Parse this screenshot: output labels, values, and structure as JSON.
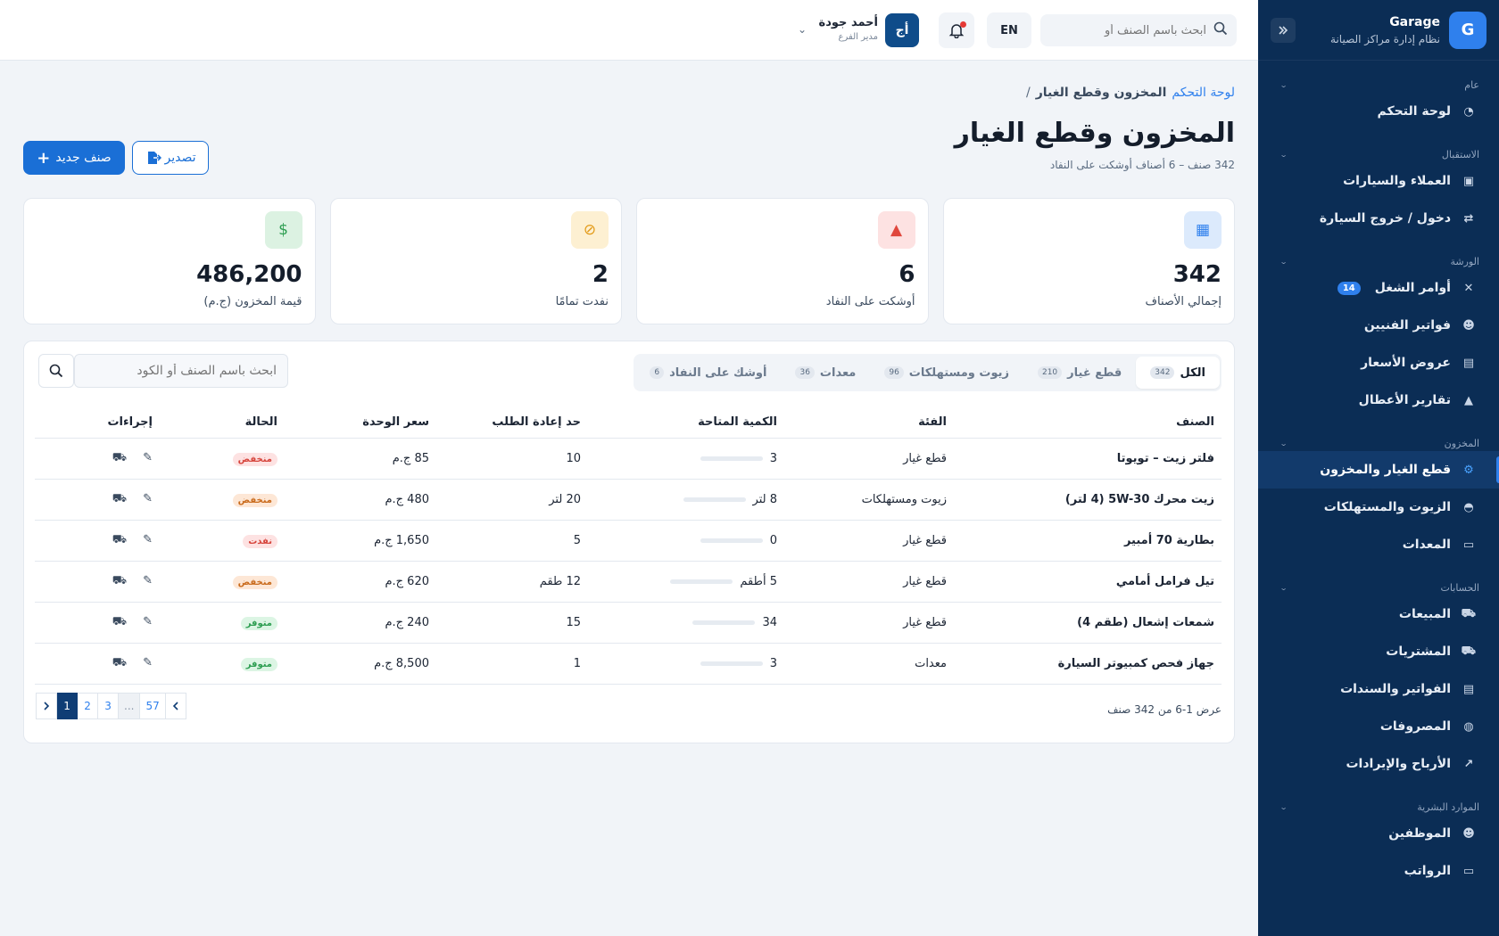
{
  "brand": {
    "name": "Garage",
    "subtitle": "نظام إدارة مراكز الصيانة",
    "logo": "G"
  },
  "sidebar": {
    "sections": [
      {
        "title": "عام",
        "items": [
          {
            "label": "لوحة التحكم",
            "icon": "gauge-icon",
            "glyph": "◔"
          }
        ]
      },
      {
        "title": "الاستقبال",
        "items": [
          {
            "label": "العملاء والسيارات",
            "icon": "contacts-icon",
            "glyph": "▣"
          },
          {
            "label": "دخول / خروج السيارة",
            "icon": "swap-icon",
            "glyph": "⇄"
          }
        ]
      },
      {
        "title": "الورشة",
        "items": [
          {
            "label": "أوامر الشغل",
            "icon": "tools-icon",
            "glyph": "✕",
            "badge": "14"
          },
          {
            "label": "فواتير الفنيين",
            "icon": "user-gear-icon",
            "glyph": "☻"
          },
          {
            "label": "عروض الأسعار",
            "icon": "document-icon",
            "glyph": "▤"
          },
          {
            "label": "تقارير الأعطال",
            "icon": "warning-icon",
            "glyph": "▲"
          }
        ]
      },
      {
        "title": "المخزون",
        "items": [
          {
            "label": "قطع الغيار والمخزون",
            "icon": "gears-icon",
            "glyph": "⚙",
            "active": true
          },
          {
            "label": "الزيوت والمستهلكات",
            "icon": "oil-can-icon",
            "glyph": "◓"
          },
          {
            "label": "المعدات",
            "icon": "toolbox-icon",
            "glyph": "▭"
          }
        ]
      },
      {
        "title": "الحسابات",
        "items": [
          {
            "label": "المبيعات",
            "icon": "cart-icon",
            "glyph": "⛟"
          },
          {
            "label": "المشتريات",
            "icon": "truck-icon",
            "glyph": "⛟"
          },
          {
            "label": "الفواتير والسندات",
            "icon": "invoice-icon",
            "glyph": "▤"
          },
          {
            "label": "المصروفات",
            "icon": "money-bag-icon",
            "glyph": "◍"
          },
          {
            "label": "الأرباح والإيرادات",
            "icon": "chart-line-icon",
            "glyph": "↗"
          }
        ]
      },
      {
        "title": "الموارد البشرية",
        "items": [
          {
            "label": "الموظفين",
            "icon": "users-icon",
            "glyph": "☻"
          },
          {
            "label": "الرواتب",
            "icon": "wallet-icon",
            "glyph": "▭"
          }
        ]
      }
    ]
  },
  "topbar": {
    "search_placeholder": "ابحث باسم الصنف أو",
    "lang": "EN",
    "user": {
      "initials": "أج",
      "name": "أحمد جودة",
      "role": "مدير الفرع"
    }
  },
  "breadcrumb": {
    "home": "لوحة التحكم",
    "separator": "/",
    "current": "المخزون وقطع الغيار"
  },
  "page": {
    "title": "المخزون وقطع الغيار",
    "subtitle": "342 صنف – 6 أصناف أوشكت على النفاد",
    "new_button": "صنف جديد",
    "export_button": "تصدير"
  },
  "stats": [
    {
      "value": "342",
      "label": "إجمالي الأصناف",
      "icon": "boxes-icon",
      "glyph": "▦",
      "bg": "#dceafc",
      "fg": "#2f80ed"
    },
    {
      "value": "6",
      "label": "أوشكت على النفاد",
      "icon": "alert-icon",
      "glyph": "▲",
      "bg": "#fde2e2",
      "fg": "#e0473d"
    },
    {
      "value": "2",
      "label": "نفدت تمامًا",
      "icon": "ban-icon",
      "glyph": "⊘",
      "bg": "#fdf0d2",
      "fg": "#e39a16"
    },
    {
      "value": "486,200",
      "label": "قيمة المخزون (ج.م)",
      "icon": "money-bag-icon",
      "glyph": "$",
      "bg": "#dcf2e2",
      "fg": "#2e9e52"
    }
  ],
  "tabs": [
    {
      "label": "الكل",
      "count": "342",
      "active": true
    },
    {
      "label": "قطع غيار",
      "count": "210"
    },
    {
      "label": "زيوت ومستهلكات",
      "count": "96"
    },
    {
      "label": "معدات",
      "count": "36"
    },
    {
      "label": "أوشك على النفاد",
      "count": "6"
    }
  ],
  "table": {
    "search_placeholder": "ابحث باسم الصنف أو الكود",
    "columns": [
      "الصنف",
      "الفئة",
      "الكمية المتاحة",
      "حد إعادة الطلب",
      "سعر الوحدة",
      "الحالة",
      "إجراءات"
    ],
    "rows": [
      {
        "name": "فلتر زيت – تويوتا",
        "category": "قطع غيار",
        "qty": "3",
        "qty_level": 0,
        "reorder": "10",
        "price": "85 ج.م",
        "status": "منخفض",
        "status_type": "low-red"
      },
      {
        "name": "زيت محرك 5W-30 (4 لتر)",
        "category": "زيوت ومستهلكات",
        "qty": "8 لتر",
        "qty_level": 0,
        "reorder": "20 لتر",
        "price": "480 ج.م",
        "status": "منخفض",
        "status_type": "low"
      },
      {
        "name": "بطارية 70 أمبير",
        "category": "قطع غيار",
        "qty": "0",
        "qty_level": 0,
        "reorder": "5",
        "price": "1,650 ج.م",
        "status": "نفدت",
        "status_type": "out"
      },
      {
        "name": "تيل فرامل أمامي",
        "category": "قطع غيار",
        "qty": "5 أطقم",
        "qty_level": 0,
        "reorder": "12 طقم",
        "price": "620 ج.م",
        "status": "منخفض",
        "status_type": "low"
      },
      {
        "name": "شمعات إشعال (طقم 4)",
        "category": "قطع غيار",
        "qty": "34",
        "qty_level": 0,
        "reorder": "15",
        "price": "240 ج.م",
        "status": "متوفر",
        "status_type": "ok"
      },
      {
        "name": "جهاز فحص كمبيوتر السيارة",
        "category": "معدات",
        "qty": "3",
        "qty_level": 0,
        "reorder": "1",
        "price": "8,500 ج.م",
        "status": "متوفر",
        "status_type": "ok"
      }
    ]
  },
  "pagination": {
    "summary": "عرض 1-6 من 342 صنف",
    "pages": [
      "1",
      "2",
      "3",
      "...",
      "57"
    ],
    "active": "1"
  }
}
